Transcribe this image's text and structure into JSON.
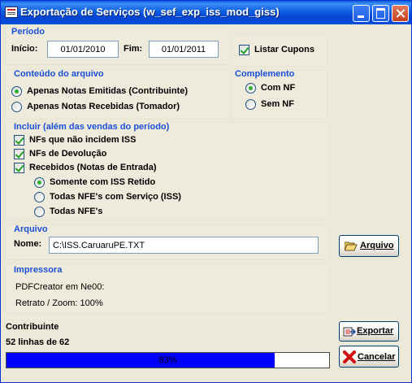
{
  "window": {
    "title": "Exportação de Serviços (w_sef_exp_iss_mod_giss)"
  },
  "periodo": {
    "heading": "Período",
    "inicio_label": "Início:",
    "inicio_value": "01/01/2010",
    "fim_label": "Fim:",
    "fim_value": "01/01/2011"
  },
  "listar_cupons": {
    "label": "Listar Cupons",
    "checked": true
  },
  "conteudo": {
    "heading": "Conteúdo do arquivo",
    "options": [
      "Apenas Notas Emitidas (Contribuinte)",
      "Apenas Notas Recebidas (Tomador)"
    ],
    "selected": 0
  },
  "complemento": {
    "heading": "Complemento",
    "options": [
      "Com NF",
      "Sem NF"
    ],
    "selected": 0
  },
  "incluir": {
    "heading": "Incluir (além das vendas do período)",
    "checks": [
      "NFs que não incidem ISS",
      "NFs de Devolução",
      "Recebidos (Notas de Entrada)"
    ],
    "sub_options": [
      "Somente com ISS Retido",
      "Todas NFE's com Serviço (ISS)",
      "Todas NFE's"
    ],
    "sub_selected": 0
  },
  "arquivo": {
    "heading": "Arquivo",
    "nome_label": "Nome:",
    "nome_value": "C:\\ISS.CaruaruPE.TXT",
    "button_label": "Arquivo"
  },
  "impressora": {
    "heading": "Impressora",
    "line1": "PDFCreator em Ne00:",
    "line2": "Retrato / Zoom: 100%"
  },
  "status": {
    "contribuinte": "Contribuinte",
    "linhas": "52 linhas de 62"
  },
  "progress": {
    "text": "83%",
    "fraction": 0.83,
    "color": "#0000ff"
  },
  "buttons": {
    "exportar": "Exportar",
    "cancelar": "Cancelar"
  }
}
